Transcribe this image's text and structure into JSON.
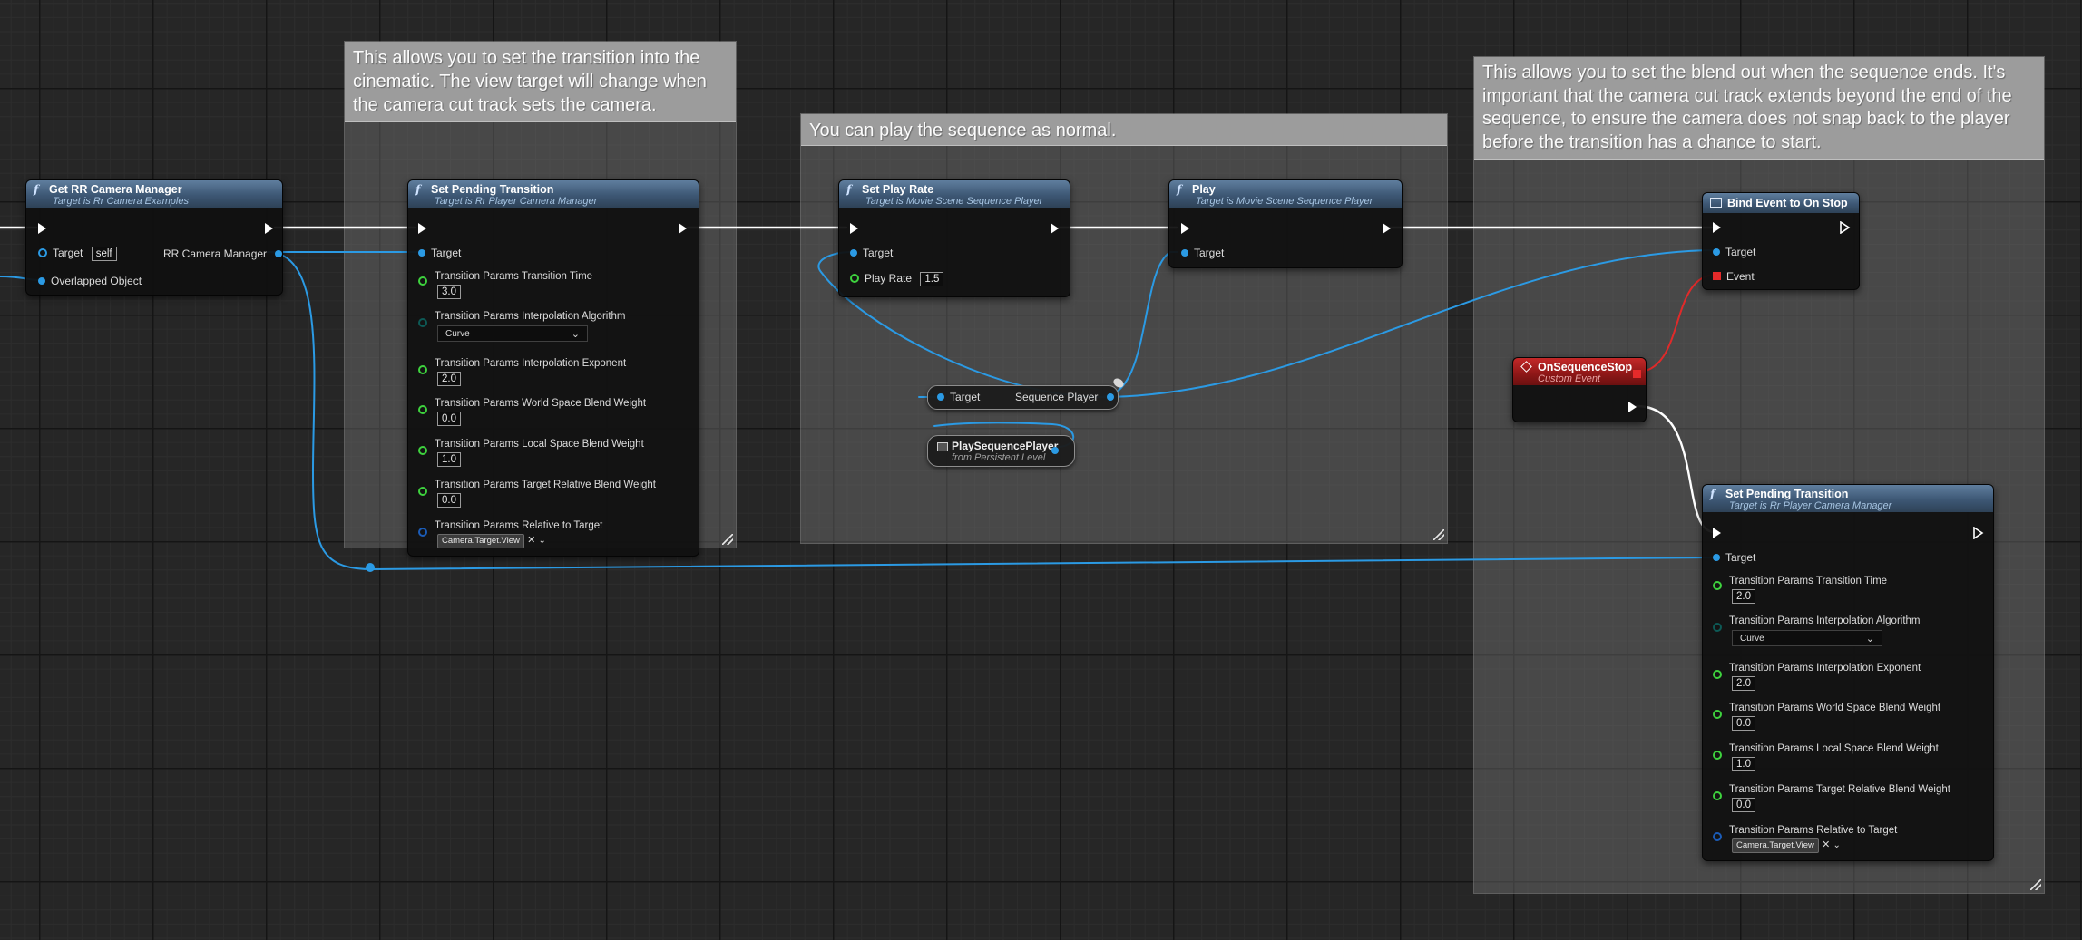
{
  "comments": {
    "transition_in": "This allows you to set the transition into the cinematic.  The view target will change when the camera cut track sets the camera.",
    "play": "You can play the sequence as normal.",
    "blend_out": "This allows you to set the blend out when the sequence ends. It's important that the camera cut track extends beyond the end of the sequence, to ensure the camera does not snap back to the player before the transition has a chance to start."
  },
  "get_manager": {
    "title": "Get RR Camera Manager",
    "subtitle": "Target is Rr Camera Examples",
    "target_label": "Target",
    "target_value": "self",
    "output_label": "RR Camera Manager",
    "overlapped_label": "Overlapped Object"
  },
  "spt1": {
    "title": "Set Pending Transition",
    "subtitle": "Target is Rr Player Camera Manager",
    "target_label": "Target",
    "p_time": "Transition Params Transition Time",
    "v_time": "3.0",
    "p_algo": "Transition Params Interpolation Algorithm",
    "v_algo": "Curve",
    "p_exp": "Transition Params Interpolation Exponent",
    "v_exp": "2.0",
    "p_world": "Transition Params World Space Blend Weight",
    "v_world": "0.0",
    "p_local": "Transition Params Local Space Blend Weight",
    "v_local": "1.0",
    "p_rel": "Transition Params Target Relative Blend Weight",
    "v_rel": "0.0",
    "p_reltarget": "Transition Params Relative to Target",
    "v_reltarget": "Camera.Target.View"
  },
  "set_play_rate": {
    "title": "Set Play Rate",
    "subtitle": "Target is Movie Scene Sequence Player",
    "target_label": "Target",
    "rate_label": "Play Rate",
    "rate_value": "1.5"
  },
  "play": {
    "title": "Play",
    "subtitle": "Target is Movie Scene Sequence Player",
    "target_label": "Target"
  },
  "get_seq_player": {
    "target_label": "Target",
    "output_label": "Sequence Player"
  },
  "play_seq_ref": {
    "title": "PlaySequencePlayer",
    "subtitle": "from Persistent Level"
  },
  "bind_event": {
    "title": "Bind Event to On Stop",
    "target_label": "Target",
    "event_label": "Event"
  },
  "on_stop": {
    "title": "OnSequenceStop",
    "subtitle": "Custom Event"
  },
  "spt2": {
    "title": "Set Pending Transition",
    "subtitle": "Target is Rr Player Camera Manager",
    "target_label": "Target",
    "p_time": "Transition Params Transition Time",
    "v_time": "2.0",
    "p_algo": "Transition Params Interpolation Algorithm",
    "v_algo": "Curve",
    "p_exp": "Transition Params Interpolation Exponent",
    "v_exp": "2.0",
    "p_world": "Transition Params World Space Blend Weight",
    "v_world": "0.0",
    "p_local": "Transition Params Local Space Blend Weight",
    "v_local": "1.0",
    "p_rel": "Transition Params Target Relative Blend Weight",
    "v_rel": "0.0",
    "p_reltarget": "Transition Params Relative to Target",
    "v_reltarget": "Camera.Target.View"
  },
  "colors": {
    "exec_wire": "#ffffff",
    "object_wire": "#2b9ae4",
    "delegate_wire": "#e02a2a",
    "float_pin": "#3ed33e",
    "node_header": "#3d5774",
    "event_header": "#8d1717"
  }
}
